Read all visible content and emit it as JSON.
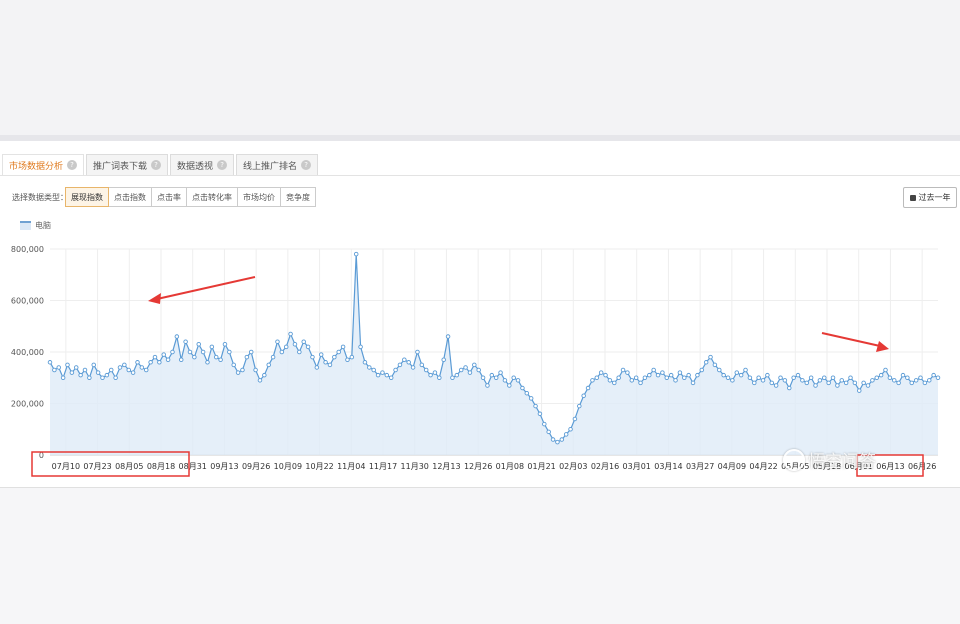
{
  "tabs": [
    {
      "label": "市场数据分析",
      "active": true
    },
    {
      "label": "推广词表下载",
      "active": false
    },
    {
      "label": "数据透视",
      "active": false
    },
    {
      "label": "线上推广排名",
      "active": false
    }
  ],
  "tab_help": "?",
  "filter": {
    "label": "选择数据类型：",
    "types": [
      "展现指数",
      "点击指数",
      "点击率",
      "点击转化率",
      "市场均价",
      "竞争度"
    ],
    "active_index": 0
  },
  "range_button": "过去一年",
  "watermark": "悟空问答",
  "colors": {
    "line": "#5b9bd5",
    "area": "#deebf7",
    "active_tab": "#e07a1e",
    "annotation": "#e53935"
  },
  "chart_data": {
    "type": "area",
    "legend": [
      "电脑"
    ],
    "y_ticks": [
      "0",
      "200,000",
      "400,000",
      "600,000",
      "800,000"
    ],
    "ylim": [
      0,
      800000
    ],
    "x_tick_labels": [
      "07月10",
      "07月23",
      "08月05",
      "08月18",
      "08月31",
      "09月13",
      "09月26",
      "10月09",
      "10月22",
      "11月04",
      "11月17",
      "11月30",
      "12月13",
      "12月26",
      "01月08",
      "01月21",
      "02月03",
      "02月16",
      "03月01",
      "03月14",
      "03月27",
      "04月09",
      "04月22",
      "05月05",
      "05月18",
      "06月01",
      "06月13",
      "06月26"
    ],
    "grid": true,
    "series": [
      {
        "name": "电脑",
        "values": [
          360000,
          330000,
          340000,
          300000,
          350000,
          320000,
          340000,
          310000,
          330000,
          300000,
          350000,
          320000,
          300000,
          310000,
          330000,
          300000,
          340000,
          350000,
          330000,
          320000,
          360000,
          340000,
          330000,
          360000,
          380000,
          360000,
          390000,
          370000,
          400000,
          460000,
          370000,
          440000,
          400000,
          380000,
          430000,
          400000,
          360000,
          420000,
          380000,
          370000,
          430000,
          400000,
          350000,
          320000,
          330000,
          380000,
          400000,
          330000,
          290000,
          310000,
          350000,
          380000,
          440000,
          400000,
          420000,
          470000,
          430000,
          400000,
          440000,
          420000,
          380000,
          340000,
          390000,
          360000,
          350000,
          380000,
          400000,
          420000,
          370000,
          380000,
          780000,
          420000,
          360000,
          340000,
          330000,
          310000,
          320000,
          310000,
          300000,
          330000,
          350000,
          370000,
          360000,
          340000,
          400000,
          350000,
          330000,
          310000,
          320000,
          300000,
          370000,
          460000,
          300000,
          310000,
          330000,
          340000,
          320000,
          350000,
          330000,
          300000,
          270000,
          310000,
          300000,
          320000,
          290000,
          270000,
          300000,
          290000,
          260000,
          240000,
          220000,
          190000,
          160000,
          120000,
          90000,
          60000,
          50000,
          60000,
          80000,
          100000,
          140000,
          190000,
          230000,
          260000,
          290000,
          300000,
          320000,
          310000,
          290000,
          280000,
          300000,
          330000,
          320000,
          290000,
          300000,
          280000,
          300000,
          310000,
          330000,
          310000,
          320000,
          300000,
          310000,
          290000,
          320000,
          300000,
          310000,
          280000,
          310000,
          330000,
          360000,
          380000,
          350000,
          330000,
          310000,
          300000,
          290000,
          320000,
          310000,
          330000,
          300000,
          280000,
          300000,
          290000,
          310000,
          280000,
          270000,
          300000,
          290000,
          260000,
          300000,
          310000,
          290000,
          280000,
          300000,
          270000,
          290000,
          300000,
          280000,
          300000,
          270000,
          290000,
          280000,
          300000,
          280000,
          250000,
          280000,
          270000,
          290000,
          300000,
          310000,
          330000,
          300000,
          290000,
          280000,
          310000,
          300000,
          280000,
          290000,
          300000,
          280000,
          290000,
          310000,
          300000
        ]
      }
    ],
    "annotations": [
      "arrow",
      "arrow",
      "highlight-box",
      "highlight-box"
    ]
  }
}
